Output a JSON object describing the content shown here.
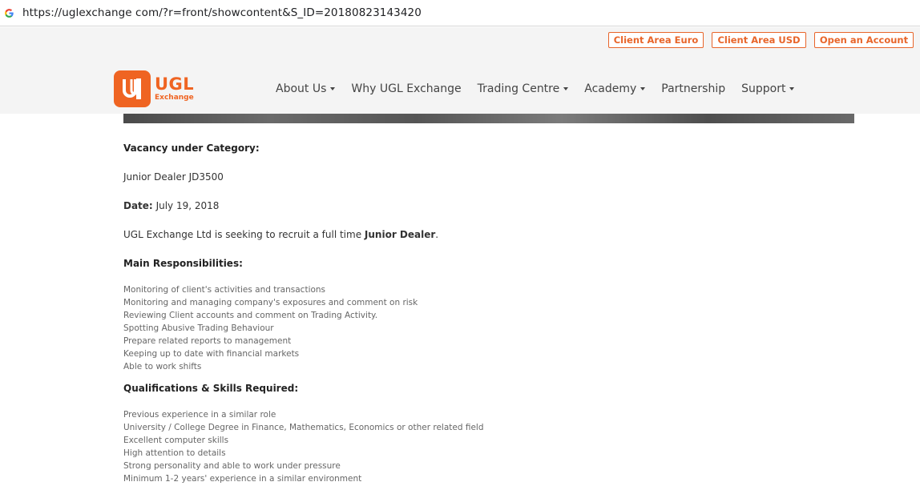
{
  "browser": {
    "url": "https://uglexchange com/?r=front/showcontent&S_ID=20180823143420"
  },
  "topbar": {
    "client_euro": "Client Area Euro",
    "client_usd": "Client Area USD",
    "open_account": "Open an Account"
  },
  "logo": {
    "name": "UGL",
    "sub": "Exchange"
  },
  "nav": {
    "items": [
      {
        "label": "About Us"
      },
      {
        "label": "Why UGL Exchange"
      },
      {
        "label": "Trading Centre"
      },
      {
        "label": "Academy"
      },
      {
        "label": "Partnership"
      },
      {
        "label": "Support"
      }
    ]
  },
  "colors": {
    "accent": "#ef6422"
  },
  "content": {
    "vacancy_heading": "Vacancy under Category:",
    "vacancy_value": "Junior Dealer JD3500",
    "date_label": "Date:",
    "date_value": "July 19, 2018",
    "intro_prefix": "UGL Exchange Ltd is seeking to recruit a full time ",
    "intro_bold": "Junior Dealer",
    "intro_suffix": ".",
    "responsibilities_heading": "Main Responsibilities:",
    "responsibilities": [
      "Monitoring of client's activities and transactions",
      "Monitoring and managing company's exposures and comment on risk",
      "Reviewing Client accounts and comment on Trading Activity.",
      "Spotting Abusive Trading Behaviour",
      "Prepare related reports to management",
      "Keeping up to date with financial markets",
      "Able to work shifts"
    ],
    "qualifications_heading": "Qualifications & Skills Required:",
    "qualifications": [
      "Previous experience in a similar role",
      "University / College Degree in Finance, Mathematics, Economics or other related field",
      "Excellent computer skills",
      "High attention to details",
      "Strong personality and able to work under pressure",
      "Minimum 1-2 years' experience in a similar environment"
    ]
  }
}
